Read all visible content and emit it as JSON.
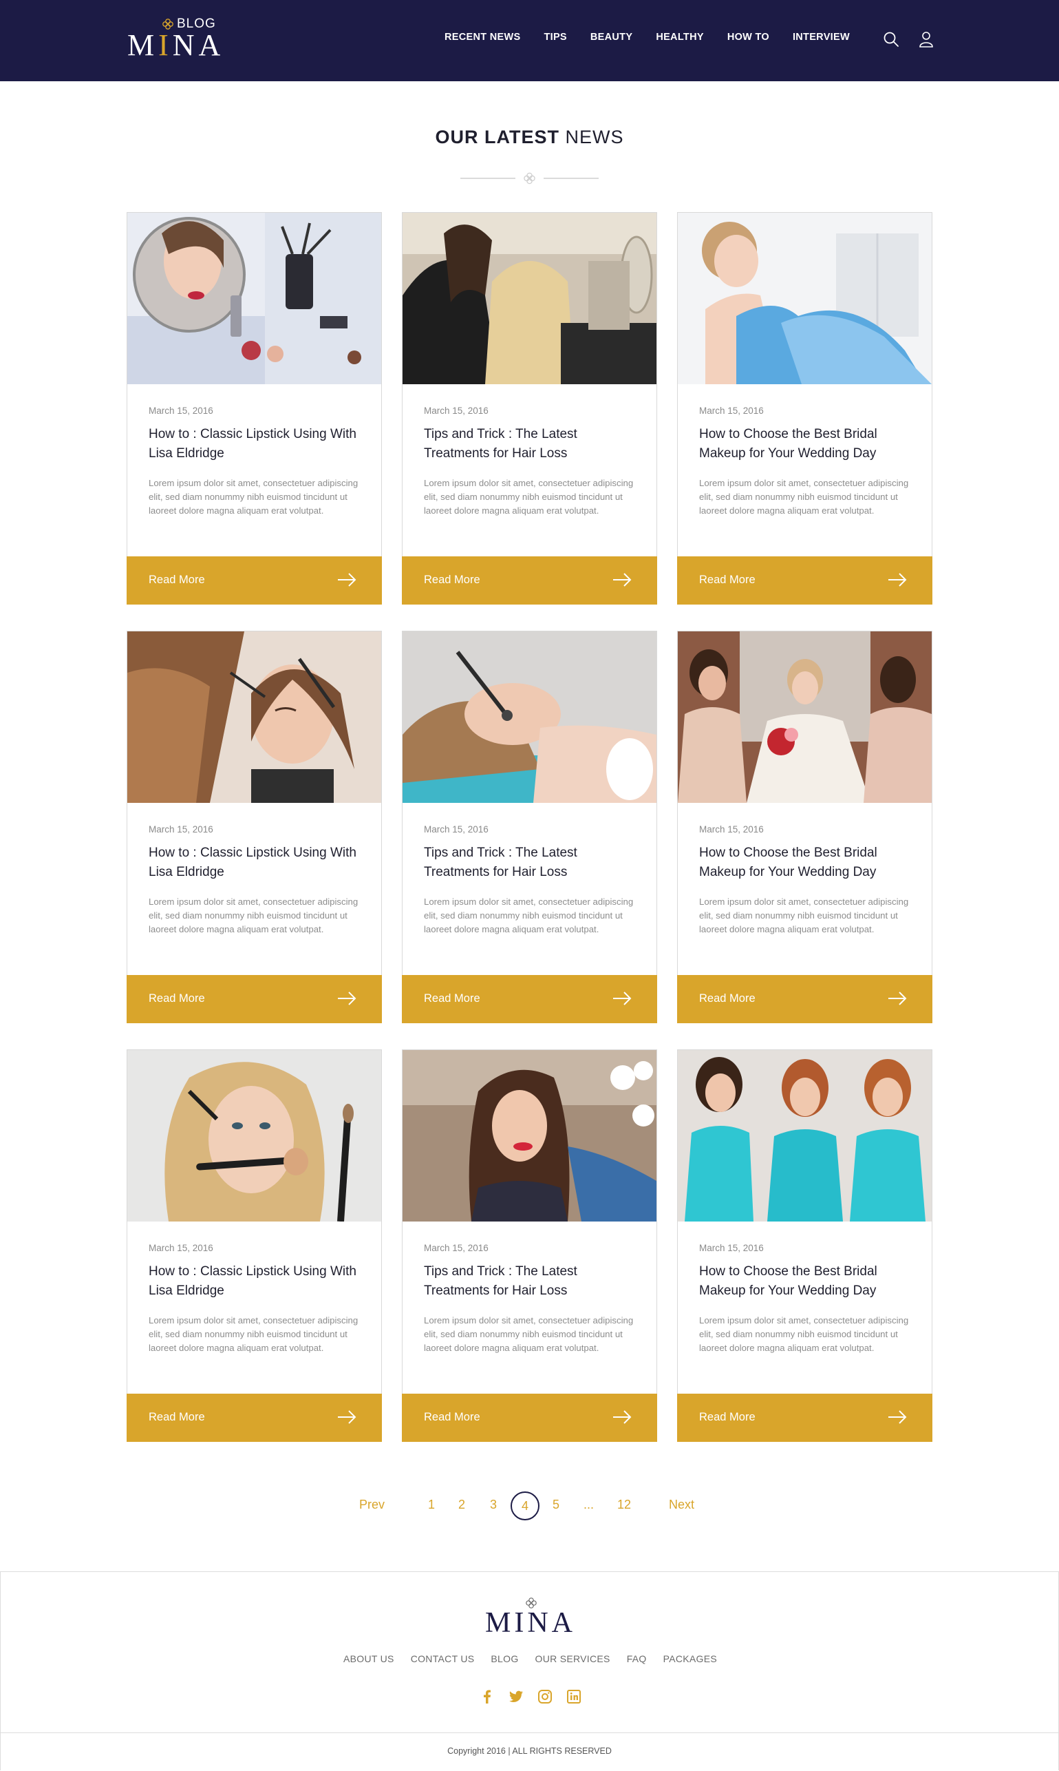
{
  "header": {
    "logo_small": "BLOG",
    "logo_main_pre": "M",
    "logo_main_accent": "I",
    "logo_main_post": "NA",
    "nav": [
      "RECENT NEWS",
      "TIPS",
      "BEAUTY",
      "HEALTHY",
      "HOW TO",
      "INTERVIEW"
    ],
    "icons": [
      "search-icon",
      "user-icon"
    ]
  },
  "section": {
    "title_bold": "OUR LATEST",
    "title_light": "NEWS"
  },
  "posts": [
    {
      "date": "March 15, 2016",
      "title": "How to : Classic Lipstick Using With Lisa Eldridge",
      "excerpt": "Lorem ipsum dolor sit amet, consectetuer adipiscing elit, sed diam nonummy nibh euismod tincidunt ut laoreet dolore magna aliquam erat volutpat.",
      "cta": "Read More"
    },
    {
      "date": "March 15, 2016",
      "title": "Tips and Trick : The Latest Treatments for Hair Loss",
      "excerpt": "Lorem ipsum dolor sit amet, consectetuer adipiscing elit, sed diam nonummy nibh euismod tincidunt ut laoreet dolore magna aliquam erat volutpat.",
      "cta": "Read More"
    },
    {
      "date": "March 15, 2016",
      "title": "How to Choose the Best Bridal Makeup for Your Wedding Day",
      "excerpt": "Lorem ipsum dolor sit amet, consectetuer adipiscing elit, sed diam nonummy nibh euismod tincidunt ut laoreet dolore magna aliquam erat volutpat.",
      "cta": "Read More"
    },
    {
      "date": "March 15, 2016",
      "title": "How to : Classic Lipstick Using With Lisa Eldridge",
      "excerpt": "Lorem ipsum dolor sit amet, consectetuer adipiscing elit, sed diam nonummy nibh euismod tincidunt ut laoreet dolore magna aliquam erat volutpat.",
      "cta": "Read More"
    },
    {
      "date": "March 15, 2016",
      "title": "Tips and Trick : The Latest Treatments for Hair Loss",
      "excerpt": "Lorem ipsum dolor sit amet, consectetuer adipiscing elit, sed diam nonummy nibh euismod tincidunt ut laoreet dolore magna aliquam erat volutpat.",
      "cta": "Read More"
    },
    {
      "date": "March 15, 2016",
      "title": "How to Choose the Best Bridal Makeup for Your Wedding Day",
      "excerpt": "Lorem ipsum dolor sit amet, consectetuer adipiscing elit, sed diam nonummy nibh euismod tincidunt ut laoreet dolore magna aliquam erat volutpat.",
      "cta": "Read More"
    },
    {
      "date": "March 15, 2016",
      "title": "How to : Classic Lipstick Using With Lisa Eldridge",
      "excerpt": "Lorem ipsum dolor sit amet, consectetuer adipiscing elit, sed diam nonummy nibh euismod tincidunt ut laoreet dolore magna aliquam erat volutpat.",
      "cta": "Read More"
    },
    {
      "date": "March 15, 2016",
      "title": "Tips and Trick : The Latest Treatments for Hair Loss",
      "excerpt": "Lorem ipsum dolor sit amet, consectetuer adipiscing elit, sed diam nonummy nibh euismod tincidunt ut laoreet dolore magna aliquam erat volutpat.",
      "cta": "Read More"
    },
    {
      "date": "March 15, 2016",
      "title": "How to Choose the Best Bridal Makeup for Your Wedding Day",
      "excerpt": "Lorem ipsum dolor sit amet, consectetuer adipiscing elit, sed diam nonummy nibh euismod tincidunt ut laoreet dolore magna aliquam erat volutpat.",
      "cta": "Read More"
    }
  ],
  "pagination": {
    "prev": "Prev",
    "pages": [
      "1",
      "2",
      "3",
      "4",
      "5",
      "...",
      "12"
    ],
    "current": "4",
    "next": "Next"
  },
  "footer": {
    "logo": "MINA",
    "links": [
      "ABOUT US",
      "CONTACT US",
      "BLOG",
      "OUR SERVICES",
      "FAQ",
      "PACKAGES"
    ],
    "social": [
      "facebook-icon",
      "twitter-icon",
      "instagram-icon",
      "linkedin-icon"
    ],
    "copyright": "Copyright 2016 | ALL RIGHTS RESERVED"
  },
  "colors": {
    "header_bg": "#1c1b45",
    "accent": "#d9a52b",
    "text_dark": "#1f1f2e",
    "text_muted": "#8d8d8d"
  }
}
